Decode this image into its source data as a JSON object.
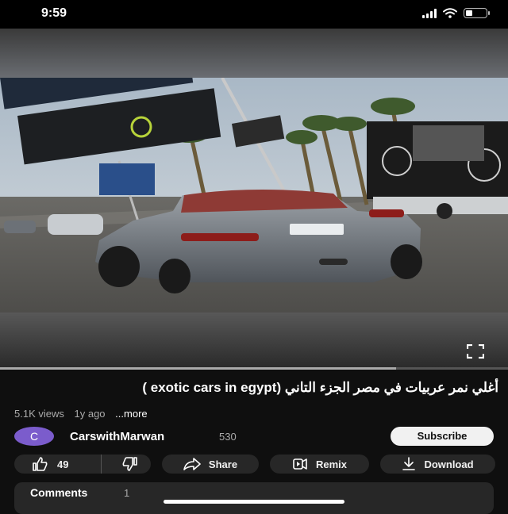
{
  "status_bar": {
    "time": "9:59"
  },
  "video": {
    "progress_fraction": 0.78
  },
  "details": {
    "title": "أغلي نمر عربيات في مصر الجزء التاني (exotic cars in egypt )",
    "views": "5.1K views",
    "age": "1y ago",
    "more": "...more"
  },
  "channel": {
    "avatar_letter": "C",
    "avatar_color": "#7b5ccc",
    "name": "CarswithMarwan",
    "subscribers": "530",
    "subscribe_label": "Subscribe"
  },
  "actions": {
    "likes": "49",
    "share": "Share",
    "remix": "Remix",
    "download": "Download"
  },
  "comments": {
    "label": "Comments",
    "count": "1"
  },
  "icons": [
    "wifi-icon",
    "battery-icon",
    "fullscreen-icon",
    "like-icon",
    "dislike-icon",
    "share-icon",
    "remix-icon",
    "download-icon"
  ]
}
